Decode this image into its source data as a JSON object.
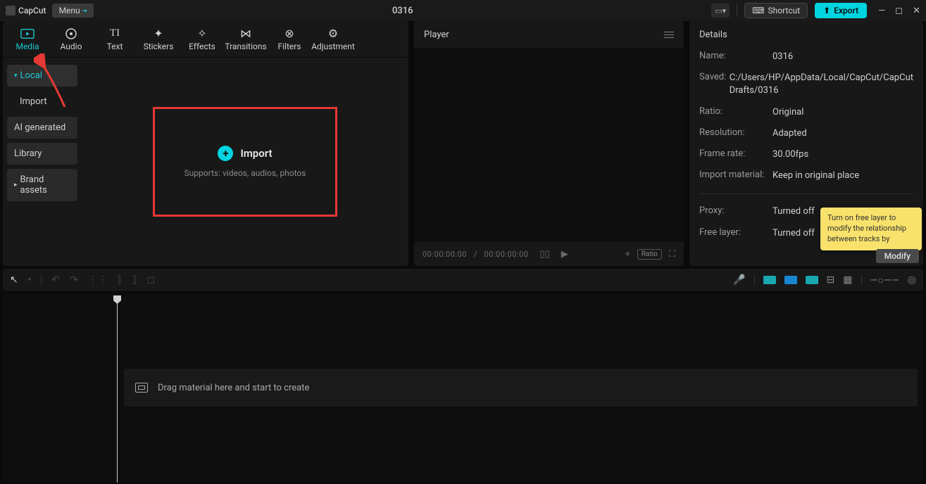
{
  "app": {
    "name": "CapCut",
    "project_title": "0316"
  },
  "titlebar": {
    "menu_label": "Menu",
    "shortcut_label": "Shortcut",
    "export_label": "Export"
  },
  "top_tabs": [
    {
      "label": "Media",
      "active": true
    },
    {
      "label": "Audio",
      "active": false
    },
    {
      "label": "Text",
      "active": false
    },
    {
      "label": "Stickers",
      "active": false
    },
    {
      "label": "Effects",
      "active": false
    },
    {
      "label": "Transitions",
      "active": false
    },
    {
      "label": "Filters",
      "active": false
    },
    {
      "label": "Adjustment",
      "active": false
    }
  ],
  "side_nav": {
    "items": [
      {
        "label": "Local",
        "selected": true,
        "expandable": true
      },
      {
        "label": "Import",
        "sub": true
      },
      {
        "label": "AI generated"
      },
      {
        "label": "Library"
      },
      {
        "label": "Brand assets",
        "expandable": true
      }
    ]
  },
  "import_box": {
    "label": "Import",
    "supports": "Supports: videos, audios, photos"
  },
  "player": {
    "title": "Player",
    "time_current": "00:00:00:00",
    "time_total": "00:00:00:00",
    "ratio_label": "Ratio"
  },
  "details": {
    "title": "Details",
    "rows": [
      {
        "label": "Name:",
        "value": "0316"
      },
      {
        "label": "Saved:",
        "value": "C:/Users/HP/AppData/Local/CapCut/CapCut Drafts/0316"
      },
      {
        "label": "Ratio:",
        "value": "Original"
      },
      {
        "label": "Resolution:",
        "value": "Adapted"
      },
      {
        "label": "Frame rate:",
        "value": "30.00fps"
      },
      {
        "label": "Import material:",
        "value": "Keep in original place"
      }
    ],
    "rows2": [
      {
        "label": "Proxy:",
        "value": "Turned off"
      },
      {
        "label": "Free layer:",
        "value": "Turned off"
      }
    ],
    "tooltip": "Turn on free layer to modify the relationship between tracks by",
    "modify_label": "Modify"
  },
  "timeline": {
    "placeholder": "Drag material here and start to create"
  }
}
